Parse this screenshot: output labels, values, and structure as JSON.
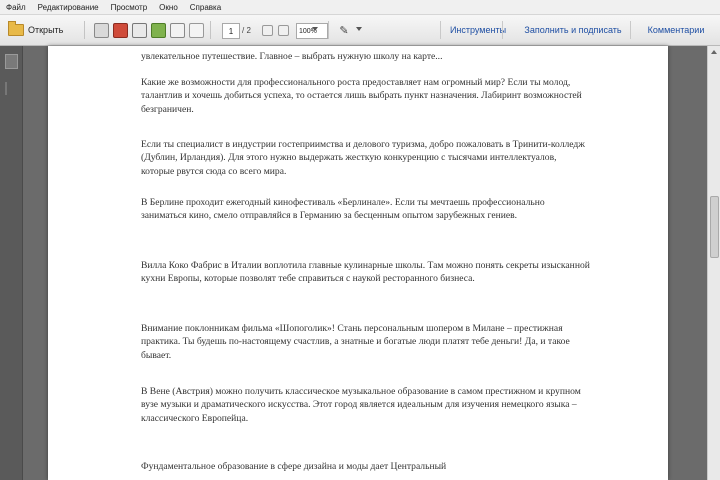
{
  "menu": [
    "Файл",
    "Редактирование",
    "Просмотр",
    "Окно",
    "Справка"
  ],
  "toolbar": {
    "open_label": "Открыть",
    "page_current": "1",
    "page_total": "/ 2",
    "zoom": "100%",
    "tools_label": "Инструменты",
    "sign_label": "Заполнить и подписать",
    "comment_label": "Комментарии"
  },
  "document": {
    "paragraphs": [
      "увлекательное путешествие. Главное – выбрать нужную школу на карте...",
      "Какие же возможности для профессионального роста предоставляет нам огромный мир? Если ты молод, талантлив и хочешь добиться успеха, то остается лишь выбрать пункт назначения. Лабиринт возможностей безграничен.",
      "Если ты специалист в индустрии гостеприимства и делового туризма, добро пожаловать в Тринити-колледж (Дублин, Ирландия). Для этого нужно выдержать жесткую конкуренцию с тысячами интеллектуалов, которые рвутся сюда со всего мира.",
      "В Берлине проходит ежегодный кинофестиваль «Берлинале». Если ты мечтаешь профессионально заниматься кино, смело отправляйся в Германию за бесценным опытом зарубежных гениев.",
      "Вилла Коко Фабрис в Италии воплотила главные кулинарные школы. Там можно понять секреты изысканной кухни Европы, которые позволят тебе справиться с наукой ресторанного бизнеса.",
      "Внимание поклонникам фильма «Шопоголик»! Стань персональным шопером в Милане – престижная практика. Ты будешь по-настоящему счастлив, а знатные и богатые люди платят тебе деньги! Да, и такое бывает.",
      "В Вене (Австрия) можно получить классическое музыкальное образование в самом престижном и крупном вузе музыки и драматического искусства. Этот город является идеальным для изучения немецкого языка – классического Европейца.",
      "Фундаментальное образование в сфере дизайна и моды дает Центральный"
    ]
  }
}
